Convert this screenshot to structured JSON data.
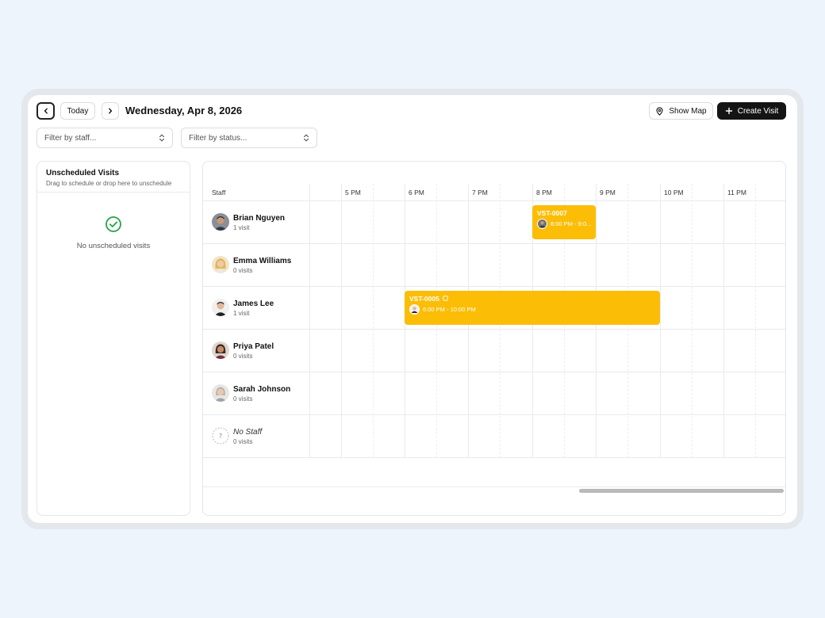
{
  "toolbar": {
    "today_label": "Today",
    "date_title": "Wednesday, Apr 8, 2026",
    "show_map_label": "Show Map",
    "create_visit_label": "Create Visit"
  },
  "filters": {
    "staff_placeholder": "Filter by staff...",
    "status_placeholder": "Filter by status..."
  },
  "unscheduled": {
    "title": "Unscheduled Visits",
    "subtitle": "Drag to schedule or drop here to unschedule",
    "empty_text": "No unscheduled visits"
  },
  "schedule": {
    "staff_header": "Staff",
    "hours": [
      "5 PM",
      "6 PM",
      "7 PM",
      "8 PM",
      "9 PM",
      "10 PM",
      "11 PM"
    ],
    "staff": [
      {
        "name": "Brian Nguyen",
        "count": "1 visit"
      },
      {
        "name": "Emma Williams",
        "count": "0 visits"
      },
      {
        "name": "James Lee",
        "count": "1 visit"
      },
      {
        "name": "Priya Patel",
        "count": "0 visits"
      },
      {
        "name": "Sarah Johnson",
        "count": "0 visits"
      },
      {
        "name": "No Staff",
        "count": "0 visits"
      }
    ],
    "visits": [
      {
        "id": "VST-0007",
        "time": "8:00 PM - 9:0..."
      },
      {
        "id": "VST-0005",
        "time": "6:00 PM - 10:00 PM"
      }
    ]
  },
  "colors": {
    "accent": "#fbbd06",
    "primary_button": "#141414",
    "success": "#22a447"
  }
}
